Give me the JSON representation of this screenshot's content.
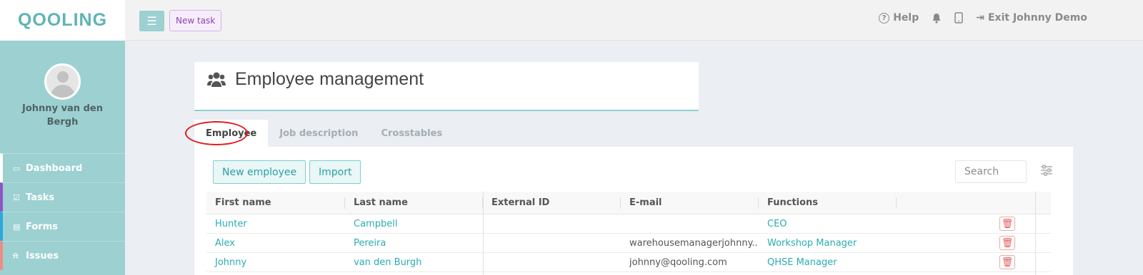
{
  "app": {
    "logo": "QOOLING"
  },
  "user": {
    "name": "Johnny van den Bergh"
  },
  "sidebar": {
    "items": [
      {
        "label": "Dashboard",
        "icon": "monitor-icon"
      },
      {
        "label": "Tasks",
        "icon": "checkbox-icon"
      },
      {
        "label": "Forms",
        "icon": "document-icon"
      },
      {
        "label": "Issues",
        "icon": "bell-icon"
      }
    ]
  },
  "topbar": {
    "new_task": "New task",
    "help": "Help",
    "exit": "Exit Johnny Demo"
  },
  "page": {
    "title": "Employee management"
  },
  "tabs": [
    "Employee",
    "Job description",
    "Crosstables"
  ],
  "toolbar": {
    "new_employee": "New employee",
    "import": "Import",
    "search_placeholder": "Search"
  },
  "table": {
    "columns": [
      "First name",
      "Last name",
      "External ID",
      "E-mail",
      "Functions"
    ],
    "rows": [
      {
        "first": "Hunter",
        "last": "Campbell",
        "external_id": "",
        "email": "",
        "function": "CEO"
      },
      {
        "first": "Alex",
        "last": "Pereira",
        "external_id": "",
        "email": "warehousemanagerjohnny...",
        "function": "Workshop Manager"
      },
      {
        "first": "Johnny",
        "last": "van den Burgh",
        "external_id": "",
        "email": "johnny@qooling.com",
        "function": "QHSE Manager"
      }
    ]
  },
  "colors": {
    "accent": "#9cd0d1",
    "link": "#2aacb2",
    "danger": "#e55a5a",
    "purple": "#8e44ad"
  }
}
